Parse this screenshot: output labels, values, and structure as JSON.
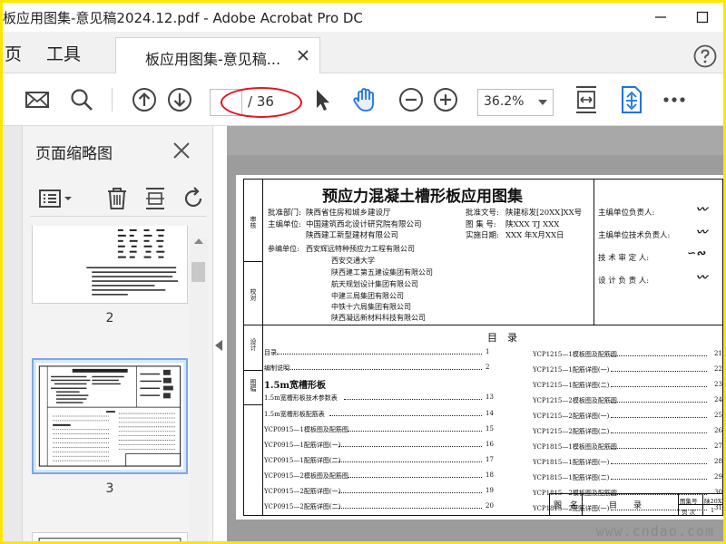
{
  "window": {
    "title": "板应用图集-意见稿2024.12.pdf - Adobe Acrobat Pro DC"
  },
  "tabs": {
    "home": "页",
    "tools": "工具",
    "document": "板应用图集-意见稿..."
  },
  "toolbar": {
    "page_current": "",
    "page_total": "/ 36",
    "zoom": "36.2%"
  },
  "left_panel": {
    "title": "页面缩略图",
    "thumbnails": [
      {
        "label": "2"
      },
      {
        "label": "3"
      }
    ]
  },
  "document": {
    "title": "预应力混凝土槽形板应用图集",
    "side_labels": [
      "审核",
      "校对",
      "设计",
      "图幅"
    ],
    "info_left": [
      {
        "label": "批准部门:",
        "value": "陕西省住房和城乡建设厅"
      },
      {
        "label": "主编单位:",
        "value": "中国建筑西北设计研究院有限公司"
      },
      {
        "label": "",
        "value": "陕西建工新型建材有限公司"
      },
      {
        "label": "参编单位:",
        "value": "西安辉远特种预应力工程有限公司"
      },
      {
        "label": "",
        "value": "西安交通大学"
      },
      {
        "label": "",
        "value": "陕西建工第五建设集团有限公司"
      },
      {
        "label": "",
        "value": "航天规划设计集团有限公司"
      },
      {
        "label": "",
        "value": "中建三局集团有限公司"
      },
      {
        "label": "",
        "value": "中铁十六局集团有限公司"
      },
      {
        "label": "",
        "value": "陕西凝远新材料科技有限公司"
      }
    ],
    "info_mid": [
      {
        "label": "批准文号:",
        "value": "陕建标发[20XX]XX号"
      },
      {
        "label": "图 集 号:",
        "value": "陕XXX  TJ XXX"
      },
      {
        "label": "实施日期:",
        "value": "XXX 年X月XX日"
      }
    ],
    "responsible": [
      {
        "label": "主编单位负责人:",
        "sign": "高么"
      },
      {
        "label": "主编单位技术负责人:",
        "sign": "高么"
      },
      {
        "label": "技 术 审 定 人:",
        "sign": "王欢城"
      },
      {
        "label": "设 计 负 责 人:",
        "sign": "高么"
      }
    ],
    "toc_heading": "目　录",
    "toc_left": [
      {
        "text": "目录",
        "page": "1"
      },
      {
        "text": "编制说明",
        "page": "2"
      },
      {
        "text": "1.5m宽槽形板",
        "page": ""
      },
      {
        "text": "1.5m宽槽形板技术参数表",
        "page": "13"
      },
      {
        "text": "1.5m宽槽形板配筋表",
        "page": "14"
      },
      {
        "text": "YCP0915—1模板图及配筋图",
        "page": "15"
      },
      {
        "text": "YCP0915—1配筋详图(一)",
        "page": "16"
      },
      {
        "text": "YCP0915—1配筋详图(二)",
        "page": "17"
      },
      {
        "text": "YCP0915—2模板图及配筋图",
        "page": "18"
      },
      {
        "text": "YCP0915—2配筋详图(一)",
        "page": "19"
      },
      {
        "text": "YCP0915—2配筋详图(二)",
        "page": "20"
      }
    ],
    "toc_right": [
      {
        "text": "YCP1215—1模板图及配筋图",
        "page": "21"
      },
      {
        "text": "YCP1215—1配筋详图(一)",
        "page": "22"
      },
      {
        "text": "YCP1215—1配筋详图(二)",
        "page": "23"
      },
      {
        "text": "YCP1215—2模板图及配筋图",
        "page": "24"
      },
      {
        "text": "YCP1215—2配筋详图(一)",
        "page": "25"
      },
      {
        "text": "YCP1215—2配筋详图(二)",
        "page": "26"
      },
      {
        "text": "YCP1815—1模板图及配筋图",
        "page": "27"
      },
      {
        "text": "YCP1815—1配筋详图(一)",
        "page": "28"
      },
      {
        "text": "YCP1815—1配筋详图(二)",
        "page": "29"
      },
      {
        "text": "YCP1815—2模板图及配筋图",
        "page": "30"
      },
      {
        "text": "YCP1815—2配筋详图(一)",
        "page": "31"
      }
    ],
    "titleblock": {
      "name_label": "图　名",
      "name_value": "目　　录",
      "set_label": "图集号",
      "set_value": "陕20XX TJ",
      "page_label": "页 次",
      "page_value": "1"
    },
    "watermark": "www.cndao.com"
  },
  "colors": {
    "frame": "#ffe600",
    "annotation": "#e0141e",
    "accent_blue": "#1f73e0"
  }
}
